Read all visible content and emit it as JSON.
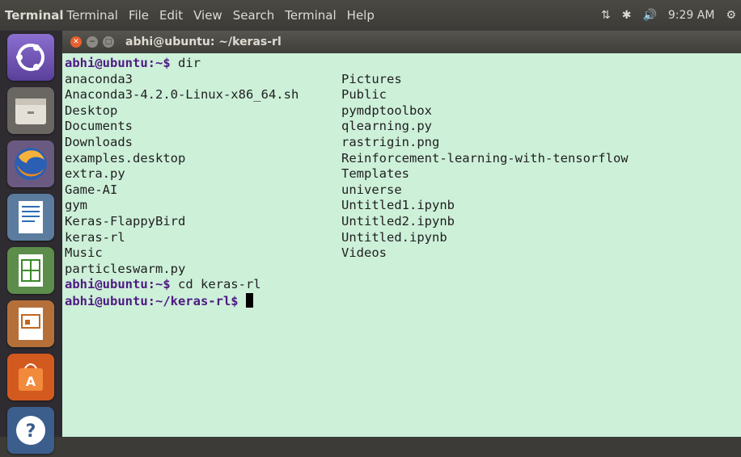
{
  "topbar": {
    "app_name": "Terminal",
    "menu": [
      "Terminal",
      "File",
      "Edit",
      "View",
      "Search",
      "Terminal",
      "Help"
    ],
    "clock": "9:29 AM"
  },
  "window": {
    "title": "abhi@ubuntu: ~/keras-rl"
  },
  "terminal": {
    "prompt1": "abhi@ubuntu:~$",
    "cmd1": " dir",
    "col1": [
      "anaconda3",
      "Anaconda3-4.2.0-Linux-x86_64.sh",
      "Desktop",
      "Documents",
      "Downloads",
      "examples.desktop",
      "extra.py",
      "Game-AI",
      "gym",
      "Keras-FlappyBird",
      "keras-rl",
      "Music",
      "particleswarm.py"
    ],
    "col2": [
      "Pictures",
      "Public",
      "pymdptoolbox",
      "qlearning.py",
      "rastrigin.png",
      "Reinforcement-learning-with-tensorflow",
      "Templates",
      "universe",
      "Untitled1.ipynb",
      "Untitled2.ipynb",
      "Untitled.ipynb",
      "Videos"
    ],
    "prompt2": "abhi@ubuntu:~$",
    "cmd2": " cd keras-rl",
    "prompt3": "abhi@ubuntu:~/keras-rl$"
  },
  "launcher": [
    "ubuntu-dash-icon",
    "files-icon",
    "firefox-icon",
    "writer-icon",
    "calc-icon",
    "impress-icon",
    "software-center-icon",
    "help-icon"
  ],
  "colors": {
    "terminal_bg": "#cdf0d9",
    "prompt": "#4e1a82"
  }
}
